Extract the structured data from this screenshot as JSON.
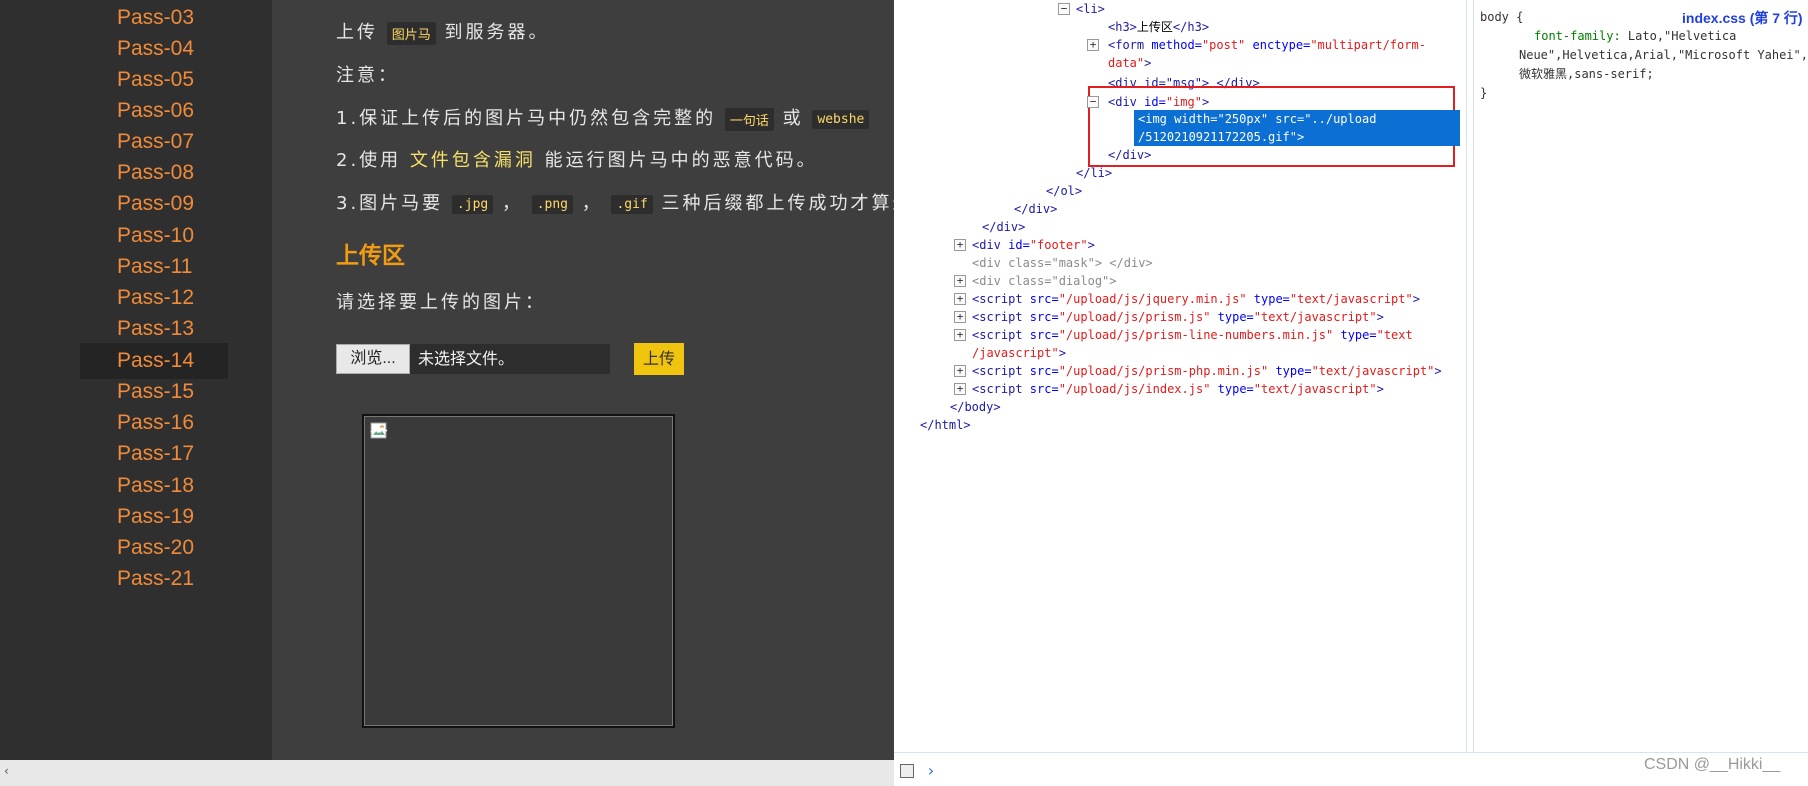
{
  "sidebar": {
    "items": [
      {
        "label": "Pass-03"
      },
      {
        "label": "Pass-04"
      },
      {
        "label": "Pass-05"
      },
      {
        "label": "Pass-06"
      },
      {
        "label": "Pass-07"
      },
      {
        "label": "Pass-08"
      },
      {
        "label": "Pass-09"
      },
      {
        "label": "Pass-10"
      },
      {
        "label": "Pass-11"
      },
      {
        "label": "Pass-12"
      },
      {
        "label": "Pass-13"
      },
      {
        "label": "Pass-14"
      },
      {
        "label": "Pass-15"
      },
      {
        "label": "Pass-16"
      },
      {
        "label": "Pass-17"
      },
      {
        "label": "Pass-18"
      },
      {
        "label": "Pass-19"
      },
      {
        "label": "Pass-20"
      },
      {
        "label": "Pass-21"
      }
    ],
    "active": "Pass-14"
  },
  "content": {
    "line1": {
      "a": "上传",
      "code": "图片马",
      "b": "到服务器。"
    },
    "note": "注意：",
    "line2": {
      "a": "1.保证上传后的图片马中仍然包含完整的",
      "code1": "一句话",
      "b": "或",
      "code2": "webshe"
    },
    "line3": {
      "a": "2.使用",
      "link": "文件包含漏洞",
      "b": "能运行图片马中的恶意代码。"
    },
    "line4": {
      "a": "3.图片马要",
      "c1": ".jpg",
      "s1": "，",
      "c2": ".png",
      "s2": "，",
      "c3": ".gif",
      "b": "三种后缀都上传成功才算过"
    },
    "upload_heading": "上传区",
    "select_prompt": "请选择要上传的图片：",
    "browse_label": "浏览...",
    "file_status": "未选择文件。",
    "upload_label": "上传"
  },
  "devtools": {
    "dom": {
      "l1": {
        "open": "<li>"
      },
      "l2": {
        "open": "<h3>",
        "text": "上传区",
        "close": "</h3>"
      },
      "l3": {
        "a": "<form ",
        "attr1": "method=",
        "val1": "\"post\"",
        "attr2": " enctype=",
        "val2": "\"multipart/form-"
      },
      "l3b": {
        "val": "data\"",
        "close": ">"
      },
      "l4": {
        "text": "<div id=\"msg\"> </div>"
      },
      "l5": {
        "a": "<div ",
        "attr": "id=",
        "val": "\"img\"",
        "close": ">"
      },
      "sel1": {
        "a": "<img ",
        "attr1": "width=",
        "val1": "\"250px\"",
        "attr2": " src=",
        "val2": "\"../upload"
      },
      "sel2": {
        "val": "/5120210921172205.gif\"",
        "close": ">"
      },
      "l6": {
        "close": "</div>"
      },
      "l7": {
        "close": "</li>"
      },
      "l8": {
        "close": "</ol>"
      },
      "l9": {
        "close": "</div>"
      },
      "l10": {
        "close": "</div>"
      },
      "l11": {
        "a": "<div ",
        "attr": "id=",
        "val": "\"footer\"",
        "close": ">"
      },
      "l12": {
        "a": "<div ",
        "attr": "class=",
        "val": "\"mask\"",
        "close": "> </div>"
      },
      "l13": {
        "a": "<div ",
        "attr": "class=",
        "val": "\"dialog\"",
        "close": ">"
      },
      "l14": {
        "a": "<script ",
        "attr1": "src=",
        "val1": "\"/upload/js/jquery.min.js\"",
        "attr2": " type=",
        "val2": "\"text/javascript\"",
        "close": ">"
      },
      "l15": {
        "a": "<script ",
        "attr1": "src=",
        "val1": "\"/upload/js/prism.js\"",
        "attr2": " type=",
        "val2": "\"text/javascript\"",
        "close": ">"
      },
      "l16": {
        "a": "<script ",
        "attr1": "src=",
        "val1": "\"/upload/js/prism-line-numbers.min.js\"",
        "attr2": " type=",
        "val2": "\"text"
      },
      "l16b": {
        "val": "/javascript\"",
        "close": ">"
      },
      "l17": {
        "a": "<script ",
        "attr1": "src=",
        "val1": "\"/upload/js/prism-php.min.js\"",
        "attr2": " type=",
        "val2": "\"text/javascript\"",
        "close": ">"
      },
      "l18": {
        "a": "<script ",
        "attr1": "src=",
        "val1": "\"/upload/js/index.js\"",
        "attr2": " type=",
        "val2": "\"text/javascript\"",
        "close": ">"
      },
      "l19": {
        "close": "</body>"
      },
      "l20": {
        "close": "</html>"
      }
    },
    "styles": {
      "selector": "body {",
      "prop": "font-family:",
      "v1": " Lato,\"Helvetica",
      "v2": "Neue\",Helvetica,Arial,\"Microsoft Yahei\",",
      "v3": "微软雅黑,sans-serif;",
      "end": "}",
      "source": "index.css (第 7 行)"
    },
    "console_prompt": "›"
  },
  "watermark": "CSDN @__Hikki__"
}
